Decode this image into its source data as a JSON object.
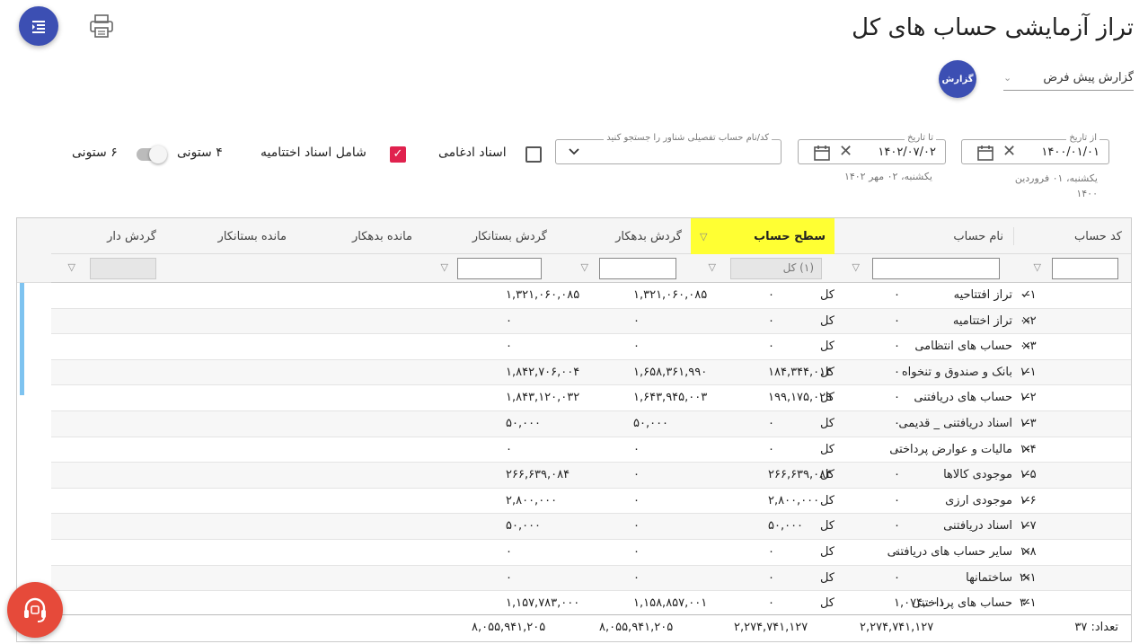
{
  "page": {
    "title": "تراز آزمایشی حساب های کل"
  },
  "toolbar": {
    "report_button": "گزارش",
    "report_select": "گزارش پیش فرض"
  },
  "filters": {
    "from_date": {
      "label": "از تاریخ",
      "value": "۱۴۰۰/۰۱/۰۱",
      "hint_line1": "یکشنبه، ۰۱ فروردین",
      "hint_line2": "۱۴۰۰"
    },
    "to_date": {
      "label": "تا تاریخ",
      "value": "۱۴۰۲/۰۷/۰۲",
      "hint": "یکشنبه، ۰۲ مهر ۱۴۰۲"
    },
    "account_search": {
      "label": "کد/نام حساب تفصیلی شناور را جستجو کنید"
    },
    "merge_docs": {
      "label": "اسناد ادغامی",
      "checked": false
    },
    "closing_docs": {
      "label": "شامل اسناد اختتامیه",
      "checked": true
    },
    "four_col": "۴ ستونی",
    "six_col": "۶ ستونی"
  },
  "grid": {
    "headers": {
      "code": "کد حساب",
      "name": "نام حساب",
      "level": "سطح حساب",
      "debit_turnover": "گردش بدهکار",
      "credit_turnover": "گردش بستانکار",
      "debit_balance": "مانده بدهکار",
      "credit_balance": "مانده بستانکار",
      "has_turnover": "گردش دار"
    },
    "level_filter": "(۱) کل",
    "rows": [
      {
        "code": "۰-۱",
        "name": "تراز افتتاحیه",
        "level": "کل",
        "dt": "۱,۳۲۱,۰۶۰,۰۸۵",
        "ct": "۱,۳۲۱,۰۶۰,۰۸۵",
        "db": "۰",
        "cb": "۰",
        "has": "✓"
      },
      {
        "code": "۰-۲",
        "name": "تراز اختتامیه",
        "level": "کل",
        "dt": "۰",
        "ct": "۰",
        "db": "۰",
        "cb": "۰",
        "has": "×"
      },
      {
        "code": "۰-۳",
        "name": "حساب های انتظامی",
        "level": "کل",
        "dt": "۰",
        "ct": "۰",
        "db": "۰",
        "cb": "۰",
        "has": "×"
      },
      {
        "code": "۱-۱",
        "name": "بانک و صندوق و تنخواه",
        "level": "کل",
        "dt": "۱,۸۴۲,۷۰۶,۰۰۴",
        "ct": "۱,۶۵۸,۳۶۱,۹۹۰",
        "db": "۱۸۴,۳۴۴,۰۱۴",
        "cb": "۰",
        "has": "✓"
      },
      {
        "code": "۱-۲",
        "name": "حساب های دریافتنی",
        "level": "کل",
        "dt": "۱,۸۴۳,۱۲۰,۰۳۲",
        "ct": "۱,۶۴۳,۹۴۵,۰۰۳",
        "db": "۱۹۹,۱۷۵,۰۲۹",
        "cb": "۰",
        "has": "✓"
      },
      {
        "code": "۱-۳",
        "name": "اسناد دریافتنی _ قدیمی",
        "level": "کل",
        "dt": "۵۰,۰۰۰",
        "ct": "۵۰,۰۰۰",
        "db": "۰",
        "cb": "۰",
        "has": "✓"
      },
      {
        "code": "۱-۴",
        "name": "مالیات و عوارض پرداختی",
        "level": "کل",
        "dt": "۰",
        "ct": "۰",
        "db": "۰",
        "cb": "۰",
        "has": "×"
      },
      {
        "code": "۱-۵",
        "name": "موجودی کالاها",
        "level": "کل",
        "dt": "۲۶۶,۶۳۹,۰۸۴",
        "ct": "۰",
        "db": "۲۶۶,۶۳۹,۰۸۴",
        "cb": "۰",
        "has": "✓"
      },
      {
        "code": "۱-۶",
        "name": "موجودی ارزی",
        "level": "کل",
        "dt": "۲,۸۰۰,۰۰۰",
        "ct": "۰",
        "db": "۲,۸۰۰,۰۰۰",
        "cb": "۰",
        "has": "✓"
      },
      {
        "code": "۱-۷",
        "name": "اسناد دریافتنی",
        "level": "کل",
        "dt": "۵۰,۰۰۰",
        "ct": "۰",
        "db": "۵۰,۰۰۰",
        "cb": "۰",
        "has": "✓"
      },
      {
        "code": "۱-۸",
        "name": "سایر حساب های دریافتنی",
        "level": "کل",
        "dt": "۰",
        "ct": "۰",
        "db": "۰",
        "cb": "۰",
        "has": "×"
      },
      {
        "code": "۲-۱",
        "name": "ساختمانها",
        "level": "کل",
        "dt": "۰",
        "ct": "۰",
        "db": "۰",
        "cb": "۰",
        "has": "×"
      },
      {
        "code": "۳-۱",
        "name": "حساب های پرداختنی",
        "level": "کل",
        "dt": "۱,۱۵۷,۷۸۳,۰۰۰",
        "ct": "۱,۱۵۸,۸۵۷,۰۰۱",
        "db": "۰",
        "cb": "۱,۰۷۴,۰۰۱",
        "has": "✓"
      }
    ],
    "footer": {
      "count": "تعداد: ۳۷",
      "dt": "۸,۰۵۵,۹۴۱,۲۰۵",
      "ct": "۸,۰۵۵,۹۴۱,۲۰۵",
      "db": "۲,۲۷۴,۷۴۱,۱۲۷",
      "cb": "۲,۲۷۴,۷۴۱,۱۲۷"
    }
  },
  "colors": {
    "primary": "#3c4fb3",
    "highlight": "#ffff33",
    "checkbox": "#e0224e",
    "support": "#e64a3a",
    "scroll": "#7ec3f0"
  }
}
